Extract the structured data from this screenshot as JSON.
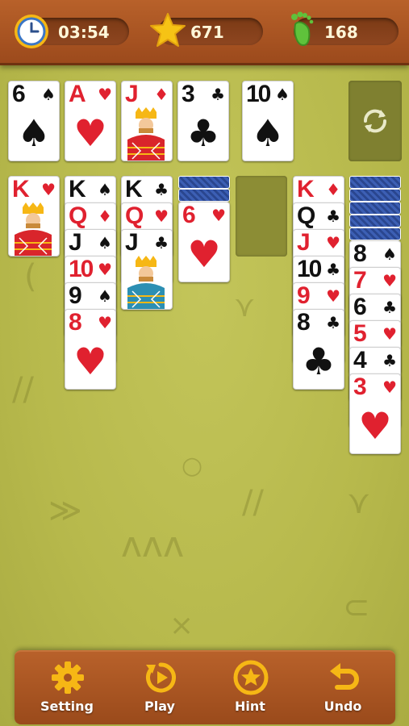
{
  "status": {
    "timer": "03:54",
    "score": "671",
    "moves": "168",
    "timer_icon": "clock-icon",
    "score_icon": "star-icon",
    "moves_icon": "footprint-icon"
  },
  "foundation": [
    {
      "rank": "6",
      "suit": "♠",
      "color": "black"
    },
    {
      "rank": "A",
      "suit": "♥",
      "color": "red"
    },
    {
      "rank": "J",
      "suit": "♦",
      "color": "red"
    },
    {
      "rank": "3",
      "suit": "♣",
      "color": "black"
    },
    {
      "rank": "10",
      "suit": "♠",
      "color": "black"
    }
  ],
  "stock": {
    "icon": "recycle-icon"
  },
  "tableau": {
    "col1": [
      {
        "rank": "K",
        "suit": "♥"
      }
    ],
    "col2": [
      {
        "rank": "K",
        "suit": "♠"
      },
      {
        "rank": "Q",
        "suit": "♦"
      },
      {
        "rank": "J",
        "suit": "♠"
      },
      {
        "rank": "10",
        "suit": "♥"
      },
      {
        "rank": "9",
        "suit": "♠"
      },
      {
        "rank": "8",
        "suit": "♥"
      }
    ],
    "col3": [
      {
        "rank": "K",
        "suit": "♣"
      },
      {
        "rank": "Q",
        "suit": "♥"
      },
      {
        "rank": "J",
        "suit": "♣"
      }
    ],
    "col4": [
      {
        "rank": "6",
        "suit": "♥"
      }
    ],
    "col6": [
      {
        "rank": "K",
        "suit": "♦"
      },
      {
        "rank": "Q",
        "suit": "♣"
      },
      {
        "rank": "J",
        "suit": "♥"
      },
      {
        "rank": "10",
        "suit": "♣"
      },
      {
        "rank": "9",
        "suit": "♥"
      },
      {
        "rank": "8",
        "suit": "♣"
      }
    ],
    "col7": [
      {
        "rank": "8",
        "suit": "♠"
      },
      {
        "rank": "7",
        "suit": "♥"
      },
      {
        "rank": "6",
        "suit": "♣"
      },
      {
        "rank": "5",
        "suit": "♥"
      },
      {
        "rank": "4",
        "suit": "♣"
      },
      {
        "rank": "3",
        "suit": "♥"
      }
    ]
  },
  "toolbar": {
    "setting_label": "Setting",
    "play_label": "Play",
    "hint_label": "Hint",
    "undo_label": "Undo"
  },
  "colors": {
    "wood": "#a8541f",
    "felt": "#b9bb4e",
    "red_suit": "#e0212f",
    "icon_gold": "#f6b715"
  }
}
